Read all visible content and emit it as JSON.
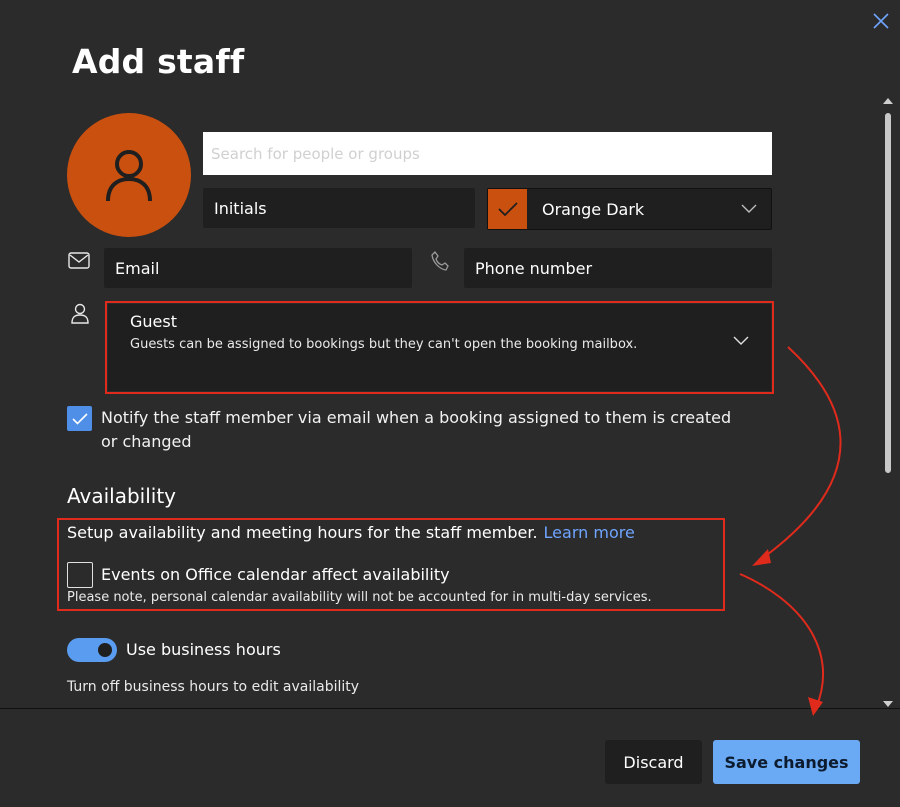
{
  "dialog": {
    "title": "Add staff"
  },
  "search": {
    "placeholder": "Search for people or groups"
  },
  "initials": {
    "value": "Initials"
  },
  "color": {
    "label": "Orange Dark",
    "swatch": "#ca5010"
  },
  "email": {
    "value": "Email"
  },
  "phone": {
    "value": "Phone number"
  },
  "role": {
    "title": "Guest",
    "description": "Guests can be assigned to bookings but they can't open the booking mailbox."
  },
  "notify": {
    "checked": true,
    "label": "Notify the staff member via email when a booking assigned to them is created or changed"
  },
  "availability": {
    "heading": "Availability",
    "setup_text": "Setup availability and meeting hours for the staff member.",
    "learn_more": "Learn more",
    "events_label": "Events on Office calendar affect availability",
    "events_checked": false,
    "note": "Please note, personal calendar availability will not be accounted for in multi-day services."
  },
  "business_hours": {
    "label": "Use business hours",
    "enabled": true,
    "hint": "Turn off business hours to edit availability"
  },
  "footer": {
    "discard_label": "Discard",
    "save_label": "Save changes"
  },
  "colors": {
    "accent": "#6aaaf5",
    "annotation": "#e02b1c",
    "background": "#2b2b2b"
  }
}
